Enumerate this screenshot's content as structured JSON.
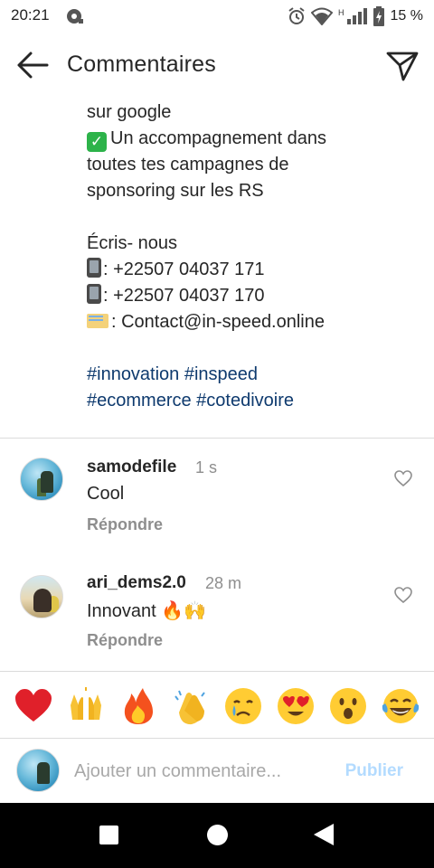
{
  "status_bar": {
    "time": "20:21",
    "battery_text": "15 %",
    "network_type": "H",
    "icons": [
      "notification-icon",
      "alarm-icon",
      "wifi-icon",
      "signal-icon",
      "battery-charging-icon"
    ]
  },
  "header": {
    "title": "Commentaires",
    "back_icon": "arrow-left-icon",
    "share_icon": "send-icon"
  },
  "caption": {
    "line1": "sur google",
    "line2": "Un accompagnement dans",
    "line3": "toutes tes campagnes de",
    "line4": "sponsoring sur les RS",
    "line5": "Écris- nous",
    "line6": ": +22507 04037 171",
    "line7": ": +22507 04037 170",
    "line8": ": Contact@in-speed.online",
    "hashtags1": "#innovation #inspeed",
    "hashtags2": "#ecommerce #cotedivoire",
    "hashtag_color": "#0e3a6e"
  },
  "comments": [
    {
      "username": "samodefile",
      "time": "1 s",
      "text": "Cool",
      "reply_label": "Répondre"
    },
    {
      "username": "ari_dems2.0",
      "time": "28 m",
      "text": "Innovant 🔥🙌",
      "reply_label": "Répondre"
    }
  ],
  "emoji_bar": [
    "❤️",
    "🙌",
    "🔥",
    "👏",
    "😢",
    "😍",
    "😮",
    "😂"
  ],
  "comment_input": {
    "placeholder": "Ajouter un commentaire...",
    "value": "",
    "publish_label": "Publier",
    "publish_color": "#b3dbff"
  },
  "nav_bar": {
    "icons": [
      "recent-apps-icon",
      "home-icon",
      "back-icon"
    ]
  }
}
